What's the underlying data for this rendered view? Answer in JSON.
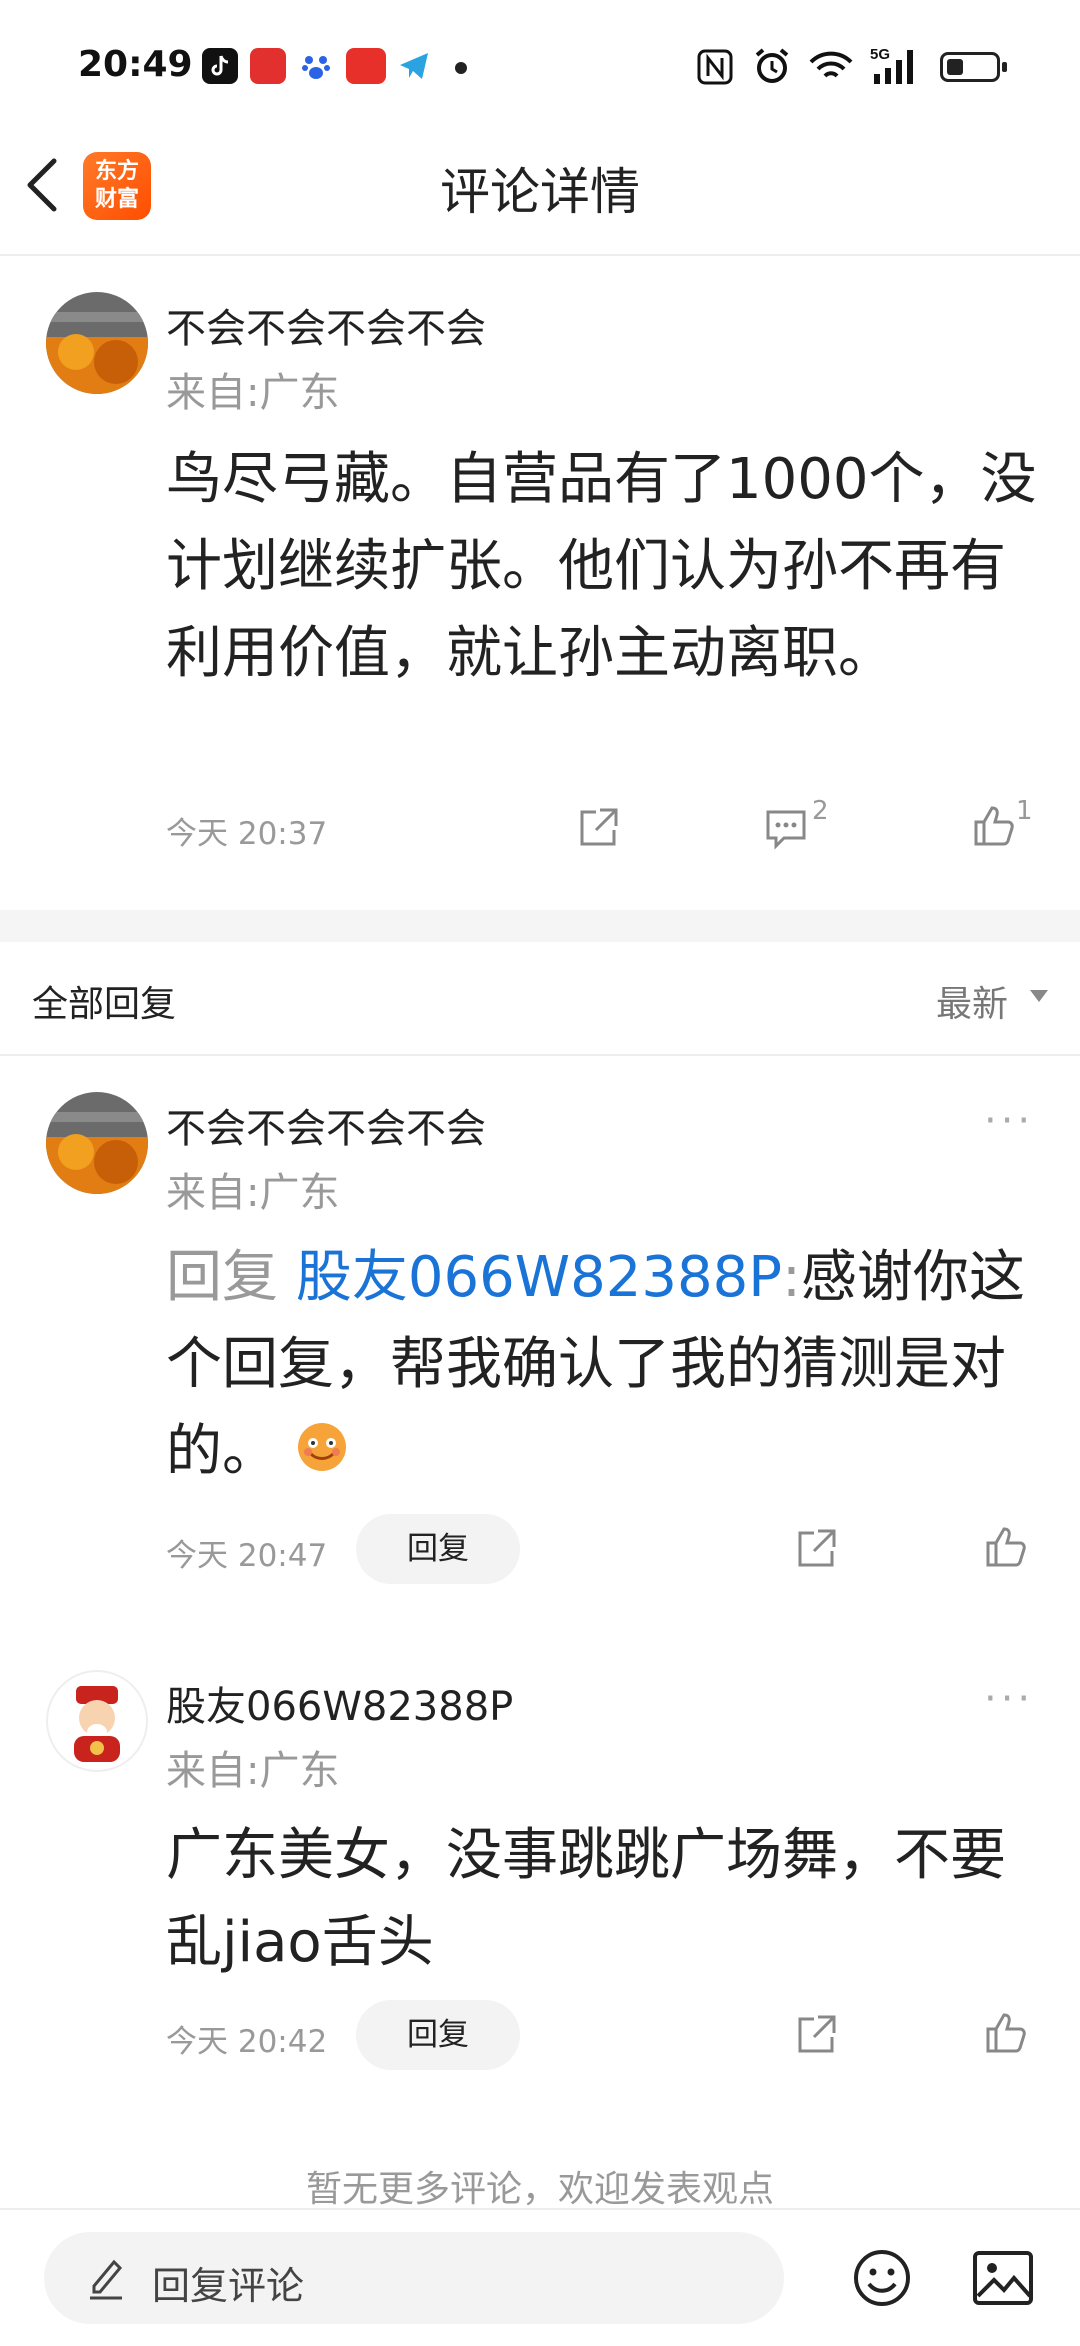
{
  "status_bar": {
    "time": "20:49",
    "icons": [
      "tiktok-icon",
      "red-app-icon",
      "baidu-paw-icon",
      "toutiao-icon",
      "telegram-icon",
      "dot-icon",
      "nfc-icon",
      "alarm-icon",
      "wifi-icon",
      "signal-5g-icon",
      "battery-icon"
    ],
    "network": "5G",
    "battery_level": 0.35
  },
  "header": {
    "title": "评论详情",
    "logo_line1": "东方",
    "logo_line2": "财富"
  },
  "main_comment": {
    "username": "不会不会不会不会",
    "location": "来自:广东",
    "text": "鸟尽弓藏。自营品有了1000个，没计划继续扩张。他们认为孙不再有利用价值，就让孙主动离职。",
    "time": "今天 20:37",
    "comment_count": "2",
    "like_count": "1"
  },
  "replies_section": {
    "title": "全部回复",
    "sort_label": "最新"
  },
  "replies": [
    {
      "username": "不会不会不会不会",
      "location": "来自:广东",
      "reply_prefix": "回复",
      "mention": "股友066W82388P",
      "separator": ":",
      "text": "感谢你这个回复，帮我确认了我的猜测是对的。",
      "time": "今天 20:47",
      "reply_label": "回复",
      "more": "···"
    },
    {
      "username": "股友066W82388P",
      "location": "来自:广东",
      "text": "广东美女，没事跳跳广场舞，不要乱jiao舌头",
      "time": "今天 20:42",
      "reply_label": "回复",
      "more": "···"
    }
  ],
  "footer": {
    "no_more": "暂无更多评论，欢迎发表观点",
    "input_placeholder": "回复评论"
  },
  "colors": {
    "mention": "#1a73d6",
    "logo": "#ff5a00",
    "muted": "#999999"
  }
}
